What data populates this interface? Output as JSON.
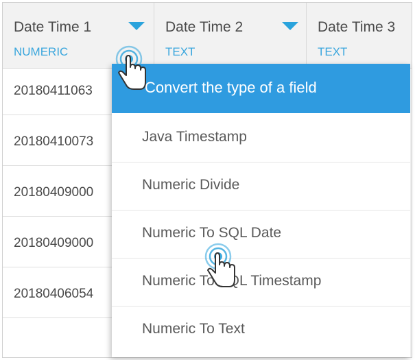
{
  "columns": [
    {
      "name": "Date Time 1",
      "type": "NUMERIC"
    },
    {
      "name": "Date Time 2",
      "type": "TEXT"
    },
    {
      "name": "Date Time 3",
      "type": "TEXT"
    }
  ],
  "rows": [
    "20180411063",
    "20180410073",
    "20180409000",
    "20180409000",
    "20180406054"
  ],
  "menu": {
    "header": "Convert the type of a field",
    "items": [
      "Java Timestamp",
      "Numeric Divide",
      "Numeric To SQL Date",
      "Numeric To SQL Timestamp",
      "Numeric To Text"
    ]
  },
  "colors": {
    "accent": "#2f9be0",
    "type_label": "#3aa6dd",
    "header_bg": "#f2f2f2"
  },
  "icons": [
    "dropdown-arrow-icon",
    "hand-cursor-icon"
  ]
}
